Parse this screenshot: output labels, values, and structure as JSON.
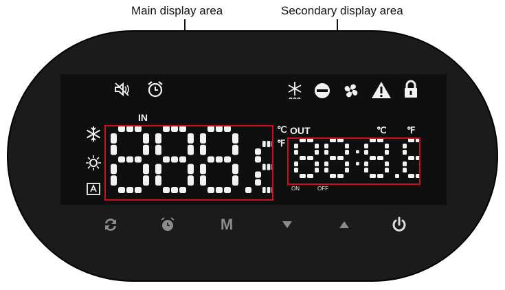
{
  "callouts": {
    "main": "Main display area",
    "secondary": "Secondary display area"
  },
  "lcd": {
    "main_label": "IN",
    "secondary_label": "OUT",
    "unit_c": "℃",
    "unit_f": "℉",
    "main_digits": "888.8",
    "secondary_digits": "88:8.8",
    "on_label": "ON",
    "off_label": "OFF",
    "mode_icons": [
      "snowflake-icon",
      "sun-icon",
      "auto-mode-icon"
    ],
    "top_left_icons": [
      "mute-icon",
      "alarm-clock-icon"
    ],
    "status_icons": [
      "defrost-icon",
      "water-pump-icon",
      "fan-icon",
      "warning-icon",
      "lock-icon"
    ]
  },
  "buttons": {
    "mode_m_label": "M",
    "items": [
      "cycle-button",
      "timer-button",
      "mode-button",
      "down-button",
      "up-button",
      "power-button"
    ]
  },
  "colors": {
    "panel": "#1b1b1b",
    "segment": "#f2f2f2",
    "highlight": "#d10f1b",
    "button": "#8c8c8c"
  }
}
